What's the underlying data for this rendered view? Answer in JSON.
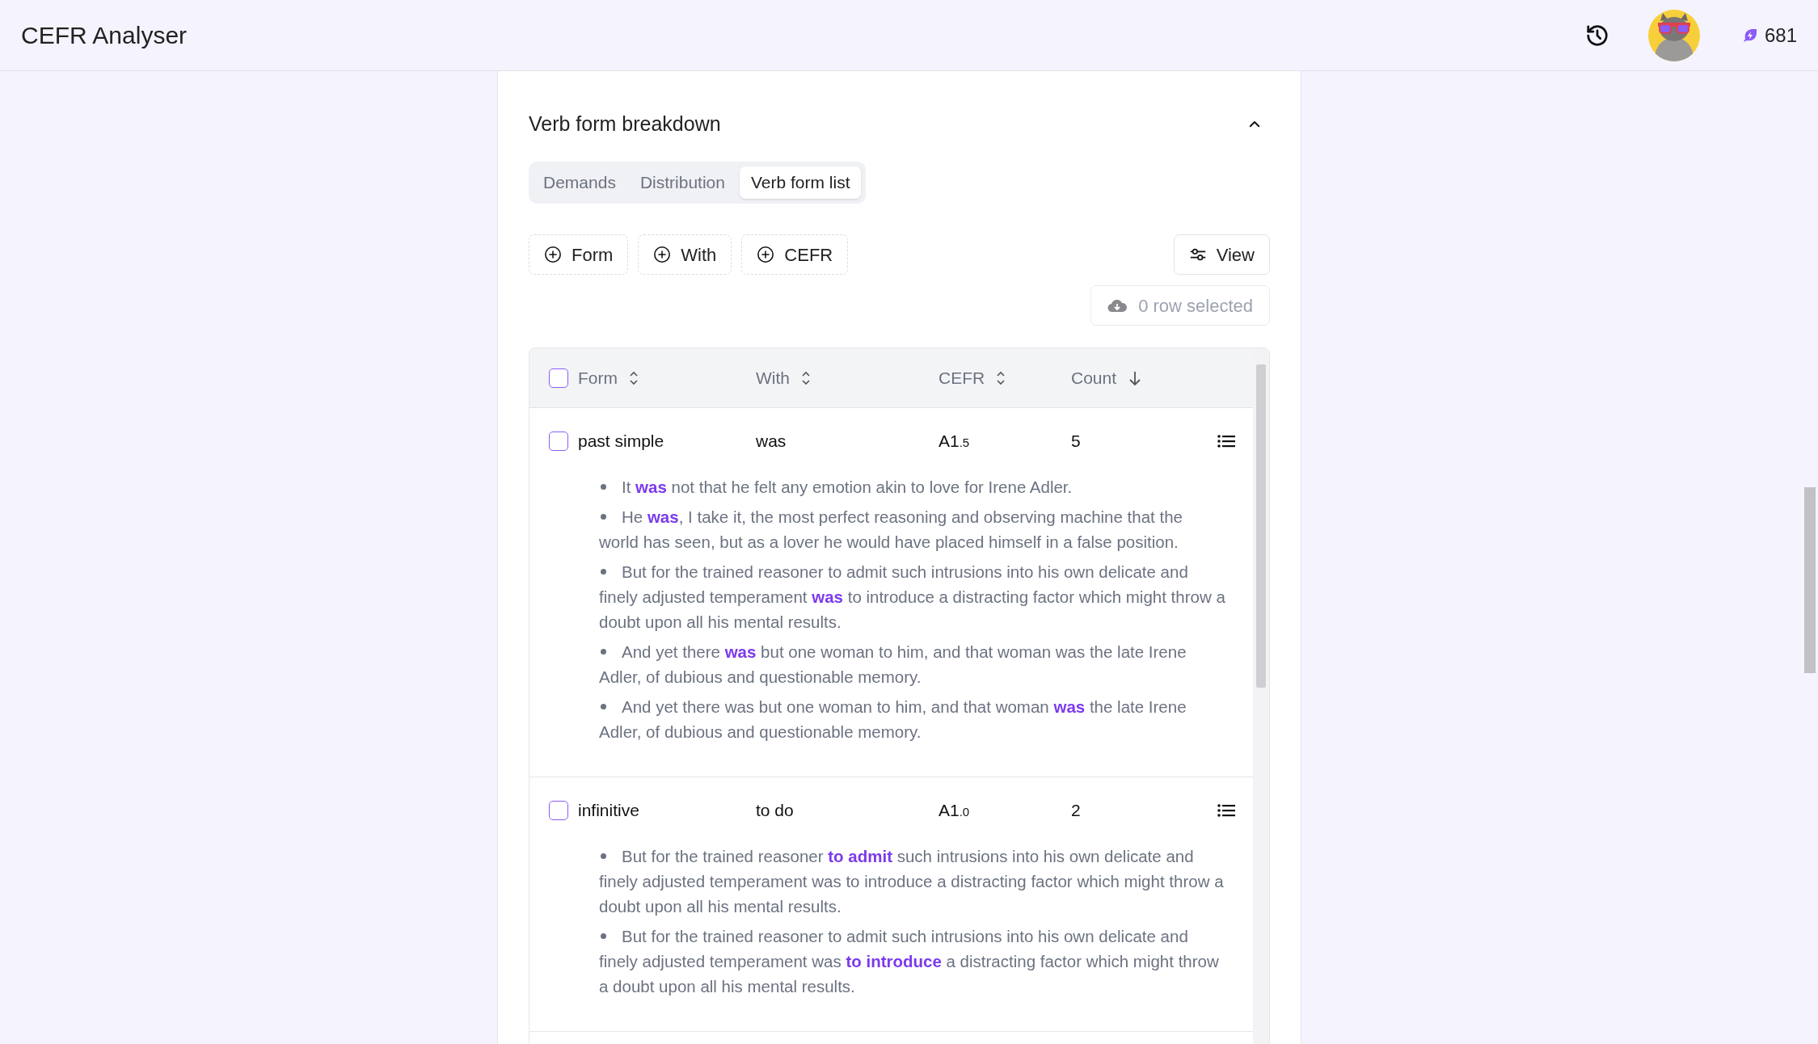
{
  "app": {
    "title": "CEFR Analyser",
    "credits": "681"
  },
  "section": {
    "title": "Verb form breakdown",
    "expanded": true
  },
  "tabs": [
    {
      "label": "Demands",
      "selected": false
    },
    {
      "label": "Distribution",
      "selected": false
    },
    {
      "label": "Verb form list",
      "selected": true
    }
  ],
  "filters": [
    "Form",
    "With",
    "CEFR"
  ],
  "view_button": "View",
  "export_button": {
    "label": "0 row selected",
    "disabled": true
  },
  "table": {
    "all_checked": false,
    "columns": [
      {
        "label": "Form",
        "sorted_desc": false
      },
      {
        "label": "With",
        "sorted_desc": false
      },
      {
        "label": "CEFR",
        "sorted_desc": false
      },
      {
        "label": "Count",
        "sorted_desc": true
      }
    ],
    "rows": [
      {
        "checked": false,
        "form": "past simple",
        "with": "was",
        "cefr": "A1",
        "cefr_fraction": ".5",
        "count": "5",
        "examples": [
          "It **was** not that he felt any emotion akin to love for Irene Adler.",
          "He **was**, I take it, the most perfect reasoning and observing machine that the world has seen, but as a lover he would have placed himself in a false position.",
          "But for the trained reasoner to admit such intrusions into his own delicate and finely adjusted temperament **was** to introduce a distracting factor which might throw a doubt upon all his mental results.",
          "And yet there **was** but one woman to him, and that woman was the late Irene Adler, of dubious and questionable memory.",
          "And yet there was but one woman to him, and that woman **was** the late Irene Adler, of dubious and questionable memory."
        ]
      },
      {
        "checked": false,
        "form": "infinitive",
        "with": "to do",
        "cefr": "A1",
        "cefr_fraction": ".0",
        "count": "2",
        "examples": [
          "But for the trained reasoner **to admit** such intrusions into his own delicate and finely adjusted temperament was to introduce a distracting factor which might throw a doubt upon all his mental results.",
          "But for the trained reasoner to admit such intrusions into his own delicate and finely adjusted temperament was **to introduce** a distracting factor which might throw a doubt upon all his mental results."
        ]
      }
    ]
  }
}
